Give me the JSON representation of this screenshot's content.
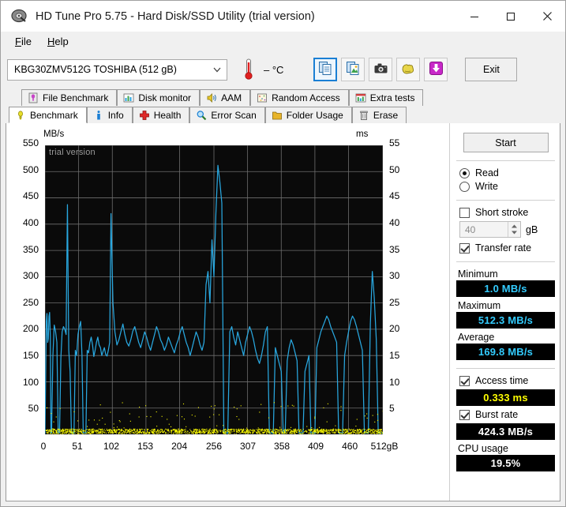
{
  "window": {
    "title": "HD Tune Pro 5.75 - Hard Disk/SSD Utility (trial version)",
    "icon": "harddisk-icon",
    "minimize_label": "–",
    "maximize_label": "□",
    "close_label": "✕"
  },
  "menu": {
    "items": [
      {
        "label": "File",
        "accel": "F"
      },
      {
        "label": "Help",
        "accel": "H"
      }
    ]
  },
  "toolbar": {
    "drive": "KBG30ZMV512G TOSHIBA (512 gB)",
    "temperature": "– °C",
    "buttons": [
      {
        "name": "copy-text-button",
        "icon": "copy-documents-icon",
        "selected": true
      },
      {
        "name": "copy-image-button",
        "icon": "copy-image-icon",
        "selected": false
      },
      {
        "name": "screenshot-button",
        "icon": "camera-icon",
        "selected": false
      },
      {
        "name": "options-button",
        "icon": "gloves-icon",
        "selected": false
      },
      {
        "name": "save-button",
        "icon": "download-arrow-icon",
        "selected": false
      }
    ],
    "exit_label": "Exit"
  },
  "tabs": {
    "row1": [
      {
        "label": "File Benchmark",
        "icon": "file-benchmark-icon",
        "active": false
      },
      {
        "label": "Disk monitor",
        "icon": "bar-chart-icon",
        "active": false
      },
      {
        "label": "AAM",
        "icon": "speaker-icon",
        "active": false
      },
      {
        "label": "Random Access",
        "icon": "random-access-icon",
        "active": false
      },
      {
        "label": "Extra tests",
        "icon": "extra-tests-icon",
        "active": false
      }
    ],
    "row2": [
      {
        "label": "Benchmark",
        "icon": "bulb-icon",
        "active": true
      },
      {
        "label": "Info",
        "icon": "info-icon",
        "active": false
      },
      {
        "label": "Health",
        "icon": "health-cross-icon",
        "active": false
      },
      {
        "label": "Error Scan",
        "icon": "magnifier-icon",
        "active": false
      },
      {
        "label": "Folder Usage",
        "icon": "folder-icon",
        "active": false
      },
      {
        "label": "Erase",
        "icon": "trash-icon",
        "active": false
      }
    ]
  },
  "panel": {
    "start_label": "Start",
    "read_label": "Read",
    "write_label": "Write",
    "read_selected": true,
    "short_stroke_label": "Short stroke",
    "short_stroke_checked": false,
    "short_stroke_value": "40",
    "short_stroke_unit": "gB",
    "transfer_rate_label": "Transfer rate",
    "transfer_rate_checked": true,
    "minimum_label": "Minimum",
    "minimum_value": "1.0 MB/s",
    "maximum_label": "Maximum",
    "maximum_value": "512.3 MB/s",
    "average_label": "Average",
    "average_value": "169.8 MB/s",
    "access_time_label": "Access time",
    "access_time_checked": true,
    "access_time_value": "0.333 ms",
    "burst_rate_label": "Burst rate",
    "burst_rate_checked": true,
    "burst_rate_value": "424.3 MB/s",
    "cpu_usage_label": "CPU usage",
    "cpu_usage_value": "19.5%"
  },
  "colors": {
    "transfer_rate_line": "#29a8e0",
    "access_time_dots": "#ffff00",
    "value_cyan": "#33ccff",
    "value_yellow": "#ffff00",
    "value_white": "#ffffff",
    "plot_background": "#0a0a0a",
    "grid": "#6f6f6f",
    "accent": "#1a7fd4"
  },
  "chart_data": {
    "type": "line",
    "title": "",
    "watermark": "trial version",
    "xlabel": "",
    "ylabel": "MB/s",
    "y2label": "ms",
    "xlim": [
      0,
      512
    ],
    "ylim": [
      0,
      550
    ],
    "y2lim": [
      0,
      55
    ],
    "grid": true,
    "xticks": [
      "0",
      "51",
      "102",
      "153",
      "204",
      "256",
      "307",
      "358",
      "409",
      "460",
      "512gB"
    ],
    "xtick_values": [
      0,
      51,
      102,
      153,
      204,
      256,
      307,
      358,
      409,
      460,
      512
    ],
    "yticks": [
      50,
      100,
      150,
      200,
      250,
      300,
      350,
      400,
      450,
      500,
      550
    ],
    "y2ticks": [
      5,
      10,
      15,
      20,
      25,
      30,
      35,
      40,
      45,
      50,
      55
    ],
    "legend": [],
    "series": [
      {
        "name": "Transfer rate",
        "unit": "MB/s",
        "axis": "left",
        "color": "#29a8e0",
        "x": [
          0,
          2,
          3,
          4,
          5,
          6,
          7,
          8,
          9,
          10,
          12,
          14,
          16,
          18,
          20,
          22,
          24,
          26,
          28,
          30,
          32,
          34,
          36,
          38,
          40,
          42,
          44,
          46,
          48,
          50,
          52,
          54,
          56,
          58,
          60,
          62,
          64,
          66,
          68,
          70,
          72,
          74,
          76,
          78,
          80,
          82,
          84,
          86,
          88,
          90,
          92,
          94,
          96,
          98,
          100,
          103,
          106,
          109,
          112,
          115,
          118,
          121,
          124,
          127,
          130,
          133,
          136,
          139,
          142,
          145,
          148,
          151,
          154,
          157,
          160,
          163,
          166,
          169,
          172,
          175,
          178,
          181,
          184,
          187,
          190,
          193,
          196,
          199,
          202,
          205,
          208,
          211,
          214,
          217,
          220,
          223,
          226,
          229,
          232,
          235,
          238,
          241,
          244,
          247,
          250,
          253,
          256,
          259,
          262,
          265,
          268,
          271,
          274,
          277,
          280,
          283,
          286,
          289,
          292,
          295,
          298,
          301,
          304,
          307,
          310,
          313,
          316,
          319,
          322,
          325,
          328,
          331,
          334,
          337,
          340,
          343,
          346,
          349,
          352,
          355,
          358,
          361,
          364,
          367,
          370,
          373,
          376,
          379,
          382,
          385,
          388,
          391,
          394,
          397,
          400,
          403,
          406,
          409,
          412,
          415,
          418,
          421,
          424,
          427,
          430,
          433,
          436,
          439,
          442,
          445,
          448,
          451,
          454,
          457,
          460,
          463,
          466,
          469,
          472,
          475,
          478,
          481,
          484,
          487,
          490,
          493,
          496,
          499,
          502,
          505,
          508,
          512
        ],
        "y": [
          2,
          215,
          230,
          175,
          182,
          225,
          232,
          186,
          2,
          3,
          150,
          208,
          196,
          175,
          2,
          3,
          145,
          195,
          205,
          200,
          190,
          437,
          160,
          120,
          2,
          3,
          2,
          160,
          150,
          190,
          205,
          215,
          150,
          2,
          3,
          2,
          160,
          155,
          175,
          185,
          170,
          148,
          160,
          175,
          185,
          170,
          165,
          150,
          158,
          165,
          152,
          149,
          160,
          175,
          420,
          250,
          195,
          170,
          180,
          195,
          210,
          190,
          175,
          168,
          180,
          196,
          205,
          190,
          175,
          165,
          180,
          195,
          185,
          170,
          160,
          175,
          190,
          205,
          195,
          180,
          172,
          160,
          170,
          185,
          175,
          165,
          155,
          170,
          180,
          195,
          205,
          190,
          175,
          165,
          150,
          165,
          180,
          195,
          185,
          170,
          160,
          175,
          285,
          310,
          250,
          370,
          300,
          420,
          512,
          480,
          440,
          2,
          3,
          2,
          195,
          205,
          185,
          170,
          195,
          180,
          165,
          150,
          175,
          190,
          205,
          195,
          180,
          160,
          145,
          135,
          150,
          170,
          195,
          205,
          2,
          3,
          2,
          165,
          150,
          135,
          120,
          2,
          3,
          140,
          165,
          180,
          170,
          155,
          140,
          2,
          3,
          2,
          120,
          135,
          150,
          2,
          3,
          2,
          165,
          180,
          195,
          205,
          215,
          225,
          218,
          205,
          195,
          185,
          175,
          2,
          3,
          2,
          150,
          175,
          195,
          215,
          225,
          218,
          205,
          190,
          175,
          160,
          2,
          3,
          2,
          210,
          310,
          260,
          180,
          2,
          3,
          2,
          140,
          160,
          175,
          185,
          178,
          168,
          160,
          172
        ]
      },
      {
        "name": "Access time",
        "unit": "ms",
        "axis": "right",
        "color": "#ffff00",
        "approx_value": 0.333,
        "note": "dense yellow dot band along bottom of plot, mostly 0.2-1.0 ms with occasional scatter up to ~6 ms"
      }
    ]
  }
}
